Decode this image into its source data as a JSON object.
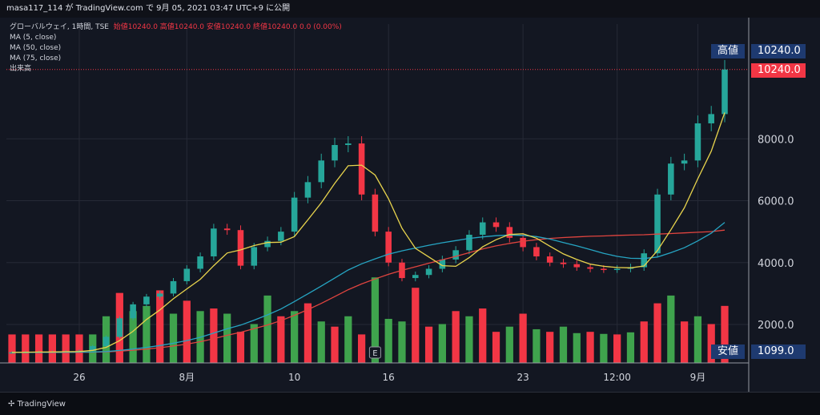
{
  "header": {
    "text": "masa117_114 が TradingView.com で 9月 05, 2021 03:47 UTC+9 に公開"
  },
  "legend": {
    "symbol": "グローバルウェイ, 1時間, TSE",
    "ohlc": "始値10240.0 高値10240.0 安値10240.0 終値10240.0 0.0 (0.00%)",
    "ma5": "MA (5, close)",
    "ma50": "MA (50, close)",
    "ma75": "MA (75, close)",
    "volume": "出来高"
  },
  "tags": {
    "high_label": "高値",
    "high_value": "10240.0",
    "last_value": "10240.0",
    "low_label": "安値",
    "low_value": "1099.0"
  },
  "footer": {
    "brand": "TradingView"
  },
  "colors": {
    "up": "#26a69a",
    "up_vol": "#3fa34d",
    "down": "#f23645",
    "ma5": "#e8d44d",
    "ma50": "#26a5c3",
    "ma75": "#e0443f",
    "bg": "#131722"
  },
  "chart_data": {
    "type": "candlestick",
    "y_ticks": [
      2000,
      4000,
      6000,
      8000
    ],
    "y_tick_labels": [
      "2000.0",
      "4000.0",
      "6000.0",
      "8000.0"
    ],
    "x_tick_labels": [
      {
        "label": "26",
        "idx": 5
      },
      {
        "label": "8月",
        "idx": 13
      },
      {
        "label": "10",
        "idx": 21
      },
      {
        "label": "16",
        "idx": 28
      },
      {
        "label": "23",
        "idx": 38
      },
      {
        "label": "12:00",
        "idx": 45
      },
      {
        "label": "9月",
        "idx": 51
      }
    ],
    "event_marker": {
      "label": "E",
      "idx": 27
    },
    "close": [
      1099,
      1110,
      1115,
      1120,
      1130,
      1150,
      1300,
      1600,
      2200,
      2650,
      2900,
      3000,
      3400,
      3800,
      4200,
      5100,
      5050,
      3900,
      4500,
      4700,
      5000,
      6100,
      6600,
      7300,
      7800,
      7850,
      6200,
      5000,
      4000,
      3500,
      3600,
      3800,
      4100,
      4400,
      4900,
      5300,
      5150,
      4800,
      4500,
      4200,
      4000,
      3950,
      3850,
      3800,
      3780,
      3800,
      3850,
      4300,
      6200,
      7200,
      7300,
      8500,
      8800,
      10240
    ],
    "volume": [
      1099,
      1099,
      1099,
      1099,
      1099,
      1099,
      1100,
      1800,
      2700,
      2000,
      2200,
      2800,
      1900,
      2400,
      2000,
      2100,
      1900,
      1200,
      1500,
      2600,
      1800,
      2000,
      2300,
      1600,
      1400,
      1800,
      1100,
      3300,
      1700,
      1600,
      2900,
      1400,
      1500,
      2000,
      1800,
      2100,
      1200,
      1400,
      1900,
      1300,
      1200,
      1400,
      1150,
      1200,
      1120,
      1100,
      1180,
      1600,
      2300,
      2600,
      1600,
      1800,
      1500,
      2200
    ],
    "vol_up": [
      false,
      false,
      false,
      false,
      false,
      false,
      true,
      true,
      false,
      true,
      true,
      false,
      true,
      false,
      true,
      false,
      true,
      false,
      true,
      true,
      false,
      true,
      false,
      true,
      false,
      true,
      false,
      true,
      true,
      true,
      false,
      false,
      true,
      false,
      true,
      false,
      false,
      true,
      false,
      true,
      false,
      true,
      true,
      false,
      true,
      false,
      true,
      false,
      false,
      true,
      false,
      true,
      false,
      false
    ],
    "ma5": [
      1099,
      1103,
      1108,
      1113,
      1119,
      1125,
      1163,
      1259,
      1476,
      1780,
      2160,
      2470,
      2830,
      3150,
      3460,
      3900,
      4310,
      4410,
      4550,
      4650,
      4660,
      4840,
      5380,
      5930,
      6560,
      7130,
      7150,
      6830,
      6060,
      5110,
      4460,
      4180,
      3900,
      3880,
      4160,
      4510,
      4740,
      4910,
      4930,
      4790,
      4530,
      4280,
      4100,
      3950,
      3880,
      3840,
      3830,
      3890,
      4390,
      5060,
      5770,
      6710,
      7600,
      8850
    ],
    "ma50": [
      1099,
      1099,
      1099,
      1100,
      1101,
      1103,
      1108,
      1125,
      1160,
      1205,
      1260,
      1320,
      1395,
      1480,
      1585,
      1720,
      1860,
      1980,
      2140,
      2310,
      2500,
      2740,
      2990,
      3240,
      3500,
      3760,
      3960,
      4120,
      4270,
      4380,
      4470,
      4560,
      4640,
      4710,
      4780,
      4830,
      4870,
      4890,
      4880,
      4840,
      4760,
      4650,
      4540,
      4420,
      4300,
      4200,
      4140,
      4130,
      4180,
      4320,
      4480,
      4700,
      4950,
      5300
    ],
    "ma75": [
      1099,
      1099,
      1099,
      1099,
      1100,
      1101,
      1104,
      1114,
      1136,
      1168,
      1206,
      1250,
      1303,
      1365,
      1442,
      1540,
      1650,
      1745,
      1862,
      1985,
      2125,
      2295,
      2480,
      2680,
      2900,
      3125,
      3310,
      3470,
      3620,
      3750,
      3865,
      3980,
      4090,
      4200,
      4320,
      4440,
      4540,
      4620,
      4690,
      4740,
      4780,
      4810,
      4830,
      4850,
      4860,
      4880,
      4890,
      4900,
      4920,
      4940,
      4960,
      4980,
      5000,
      5050
    ]
  }
}
